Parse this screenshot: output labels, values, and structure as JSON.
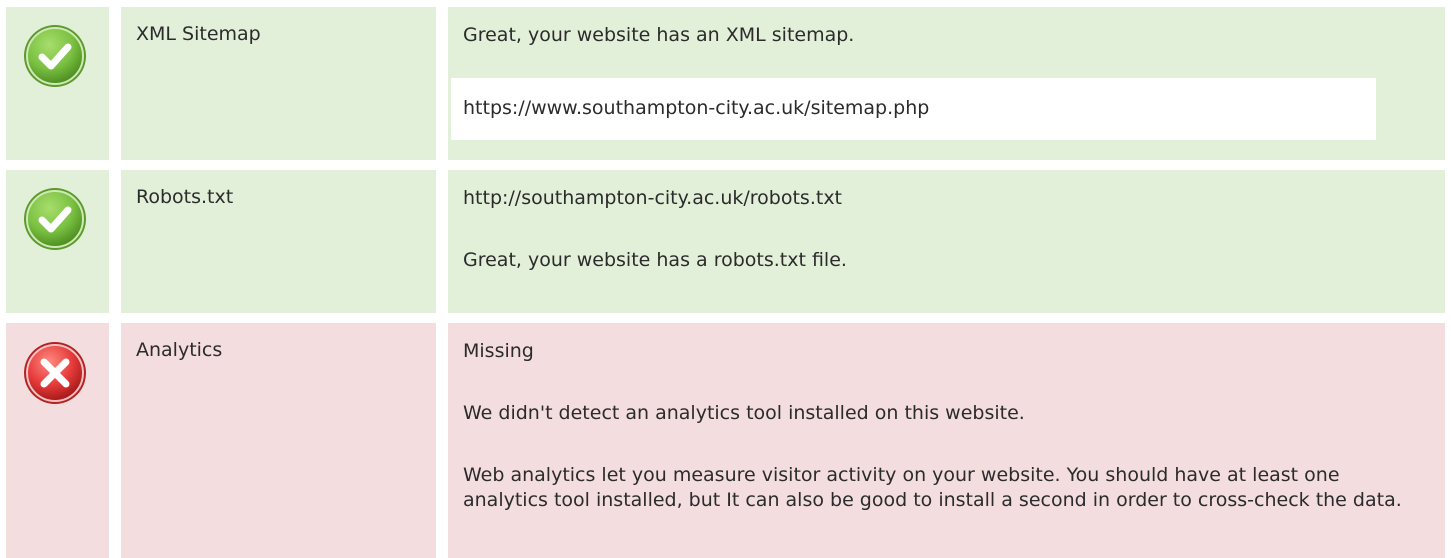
{
  "rows": [
    {
      "status": "pass",
      "icon": "check-circle-icon",
      "label": "XML Sitemap",
      "message": "Great, your website has an XML sitemap.",
      "sitemap_url": "https://www.southampton-city.ac.uk/sitemap.php"
    },
    {
      "status": "pass",
      "icon": "check-circle-icon",
      "label": "Robots.txt",
      "robots_url": "http://southampton-city.ac.uk/robots.txt",
      "message": "Great, your website has a robots.txt file."
    },
    {
      "status": "fail",
      "icon": "cross-circle-icon",
      "label": "Analytics",
      "result": "Missing",
      "message": "We didn't detect an analytics tool installed on this website.",
      "advice": "Web analytics let you measure visitor activity on your website. You should have at least one analytics tool installed, but It can also be good to install a second in order to cross-check the data."
    }
  ],
  "colors": {
    "pass_background": "#e2f0da",
    "fail_background": "#f3dddf",
    "pass_icon": "#7ac142",
    "fail_icon": "#e53a3a"
  }
}
